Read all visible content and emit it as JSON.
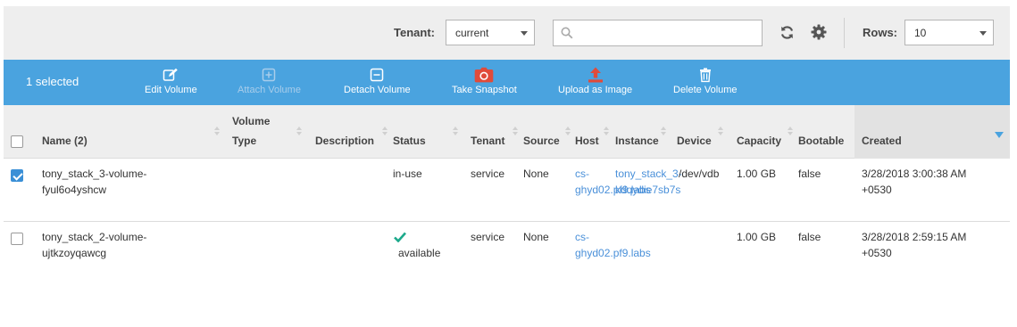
{
  "filters": {
    "tenant_label": "Tenant:",
    "tenant_value": "current",
    "search_value": "",
    "rows_label": "Rows:",
    "rows_value": "10"
  },
  "icons": {
    "search": "search-icon",
    "refresh": "refresh-icon",
    "settings": "gear-icon"
  },
  "actionbar": {
    "selected_text": "1 selected",
    "actions": [
      {
        "label": "Edit Volume",
        "icon": "edit-icon",
        "enabled": true
      },
      {
        "label": "Attach Volume",
        "icon": "plus-square-icon",
        "enabled": false
      },
      {
        "label": "Detach Volume",
        "icon": "minus-square-icon",
        "enabled": true
      },
      {
        "label": "Take Snapshot",
        "icon": "camera-icon",
        "enabled": true
      },
      {
        "label": "Upload as Image",
        "icon": "upload-icon",
        "enabled": true
      },
      {
        "label": "Delete Volume",
        "icon": "trash-icon",
        "enabled": true
      }
    ]
  },
  "colors": {
    "accent": "#4aa3df",
    "link": "#4a90d9",
    "status_ok": "#1ca98b",
    "danger_icon": "#e04b3a"
  },
  "table": {
    "columns": {
      "name": "Name (2)",
      "volume_type_1": "Volume",
      "volume_type_2": "Type",
      "description": "Description",
      "status": "Status",
      "tenant": "Tenant",
      "source": "Source",
      "host": "Host",
      "instance": "Instance",
      "device": "Device",
      "capacity": "Capacity",
      "bootable": "Bootable",
      "created": "Created"
    },
    "rows": [
      {
        "checked": true,
        "name_1": "tony_stack_3-volume-",
        "name_2": "fyul6o4yshcw",
        "status": "in-use",
        "tenant": "service",
        "source": "None",
        "host_1": "cs-",
        "host_2": "ghyd02.pf9.labs",
        "instance_1": "tony_stack_3-",
        "instance_2": "kdqydie7sb7s",
        "device": "/dev/vdb",
        "capacity": "1.00 GB",
        "bootable": "false",
        "created_1": "3/28/2018 3:00:38 AM",
        "created_2": "+0530"
      },
      {
        "checked": false,
        "name_1": "tony_stack_2-volume-",
        "name_2": "ujtkzoyqawcg",
        "status": "available",
        "tenant": "service",
        "source": "None",
        "host_1": "cs-",
        "host_2": "ghyd02.pf9.labs",
        "instance_1": "",
        "instance_2": "",
        "device": "",
        "capacity": "1.00 GB",
        "bootable": "false",
        "created_1": "3/28/2018 2:59:15 AM",
        "created_2": "+0530"
      }
    ]
  }
}
